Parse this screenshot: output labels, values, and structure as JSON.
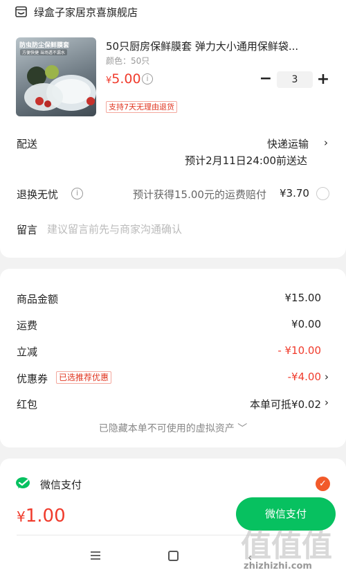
{
  "store": {
    "name": "绿盒子家居京喜旗舰店",
    "icon": "store-icon"
  },
  "product": {
    "title": "50只厨房保鲜膜套 弹力大小通用保鲜袋...",
    "spec": "颜色：50只",
    "price_currency": "¥",
    "price_value": "5.00",
    "quantity": "3",
    "minus": "−",
    "plus": "+",
    "return_tag": "支持7天无理由退货",
    "thumb_title": "防虫防尘保鲜膜套",
    "thumb_sub": "方便快捷 当场透不漏水"
  },
  "shipping": {
    "label": "配送",
    "method": "快递运输",
    "estimate": "预计2月11日24:00前送达"
  },
  "returns": {
    "label": "退换无忧",
    "info": "预计获得15.00元的运费赔付",
    "price": "¥3.70"
  },
  "message": {
    "label": "留言",
    "placeholder": "建议留言前先与商家沟通确认"
  },
  "summary": {
    "goods_label": "商品金额",
    "goods_value": "¥15.00",
    "freight_label": "运费",
    "freight_value": "¥0.00",
    "discount_label": "立减",
    "discount_value": "- ¥10.00",
    "coupon_label": "优惠券",
    "coupon_tag": "已选推荐优惠",
    "coupon_value": "-¥4.00",
    "redpacket_label": "红包",
    "redpacket_value": "本单可抵¥0.02",
    "hidden_assets": "已隐藏本单不可使用的虚拟资产 ﹀"
  },
  "payment": {
    "method": "微信支付",
    "total_currency": "¥",
    "total_value": "1.00",
    "button": "微信支付"
  },
  "watermark": {
    "text": "zhizhizhi.com",
    "glyphs": "值值值"
  },
  "colors": {
    "accent_red": "#f03b2c",
    "wechat_green": "#07c160",
    "check_orange": "#f25a2a"
  }
}
